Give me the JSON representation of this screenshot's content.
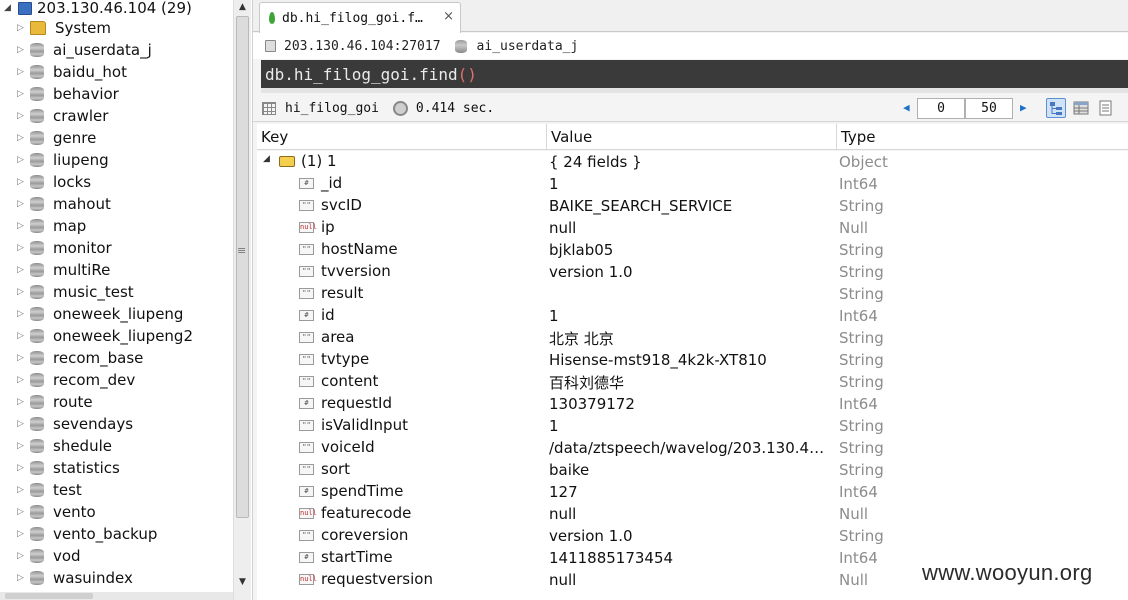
{
  "tree": {
    "root_label": "203.130.46.104 (29)",
    "items": [
      {
        "label": "System",
        "icon": "folder-icon"
      },
      {
        "label": "ai_userdata_j",
        "icon": "database-icon"
      },
      {
        "label": "baidu_hot",
        "icon": "database-icon"
      },
      {
        "label": "behavior",
        "icon": "database-icon"
      },
      {
        "label": "crawler",
        "icon": "database-icon"
      },
      {
        "label": "genre",
        "icon": "database-icon"
      },
      {
        "label": "liupeng",
        "icon": "database-icon"
      },
      {
        "label": "locks",
        "icon": "database-icon"
      },
      {
        "label": "mahout",
        "icon": "database-icon"
      },
      {
        "label": "map",
        "icon": "database-icon"
      },
      {
        "label": "monitor",
        "icon": "database-icon"
      },
      {
        "label": "multiRe",
        "icon": "database-icon"
      },
      {
        "label": "music_test",
        "icon": "database-icon"
      },
      {
        "label": "oneweek_liupeng",
        "icon": "database-icon"
      },
      {
        "label": "oneweek_liupeng2",
        "icon": "database-icon"
      },
      {
        "label": "recom_base",
        "icon": "database-icon"
      },
      {
        "label": "recom_dev",
        "icon": "database-icon"
      },
      {
        "label": "route",
        "icon": "database-icon"
      },
      {
        "label": "sevendays",
        "icon": "database-icon"
      },
      {
        "label": "shedule",
        "icon": "database-icon"
      },
      {
        "label": "statistics",
        "icon": "database-icon"
      },
      {
        "label": "test",
        "icon": "database-icon"
      },
      {
        "label": "vento",
        "icon": "database-icon"
      },
      {
        "label": "vento_backup",
        "icon": "database-icon"
      },
      {
        "label": "vod",
        "icon": "database-icon"
      },
      {
        "label": "wasuindex",
        "icon": "database-icon"
      }
    ]
  },
  "tab": {
    "label": "db.hi_filog_goi.f…",
    "close": "×"
  },
  "connection": {
    "server": "203.130.46.104:27017",
    "database": "ai_userdata_j"
  },
  "query": {
    "prefix": "db.hi_filog_goi.find",
    "parens": "()"
  },
  "result_bar": {
    "collection": "hi_filog_goi",
    "time": "0.414 sec.",
    "skip": "0",
    "limit": "50"
  },
  "grid": {
    "headers": [
      "Key",
      "Value",
      "Type"
    ],
    "root": {
      "key": "(1) 1",
      "value": "{ 24 fields }",
      "type": "Object"
    },
    "rows": [
      {
        "key": "_id",
        "value": "1",
        "type": "Int64",
        "icon": "#"
      },
      {
        "key": "svcID",
        "value": "BAIKE_SEARCH_SERVICE",
        "type": "String",
        "icon": "\"\""
      },
      {
        "key": "ip",
        "value": "null",
        "type": "Null",
        "icon": "null"
      },
      {
        "key": "hostName",
        "value": "bjklab05",
        "type": "String",
        "icon": "\"\""
      },
      {
        "key": "tvversion",
        "value": "version 1.0",
        "type": "String",
        "icon": "\"\""
      },
      {
        "key": "result",
        "value": "",
        "type": "String",
        "icon": "\"\""
      },
      {
        "key": "id",
        "value": "1",
        "type": "Int64",
        "icon": "#"
      },
      {
        "key": "area",
        "value": "北京 北京",
        "type": "String",
        "icon": "\"\""
      },
      {
        "key": "tvtype",
        "value": "Hisense-mst918_4k2k-XT810",
        "type": "String",
        "icon": "\"\""
      },
      {
        "key": "content",
        "value": "百科刘德华",
        "type": "String",
        "icon": "\"\""
      },
      {
        "key": "requestId",
        "value": "130379172",
        "type": "Int64",
        "icon": "#"
      },
      {
        "key": "isValidInput",
        "value": "1",
        "type": "String",
        "icon": "\"\""
      },
      {
        "key": "voiceId",
        "value": "/data/ztspeech/wavelog/203.130.44....",
        "type": "String",
        "icon": "\"\""
      },
      {
        "key": "sort",
        "value": "baike",
        "type": "String",
        "icon": "\"\""
      },
      {
        "key": "spendTime",
        "value": "127",
        "type": "Int64",
        "icon": "#"
      },
      {
        "key": "featurecode",
        "value": "null",
        "type": "Null",
        "icon": "null"
      },
      {
        "key": "coreversion",
        "value": "version 1.0",
        "type": "String",
        "icon": "\"\""
      },
      {
        "key": "startTime",
        "value": "1411885173454",
        "type": "Int64",
        "icon": "#"
      },
      {
        "key": "requestversion",
        "value": "null",
        "type": "Null",
        "icon": "null"
      }
    ]
  },
  "watermark": "www.wooyun.org",
  "colors": {
    "query_bg": "#3a3a3a",
    "type_text": "#8c8c8c",
    "accent": "#1f6fc9",
    "paren": "#e0706a"
  }
}
